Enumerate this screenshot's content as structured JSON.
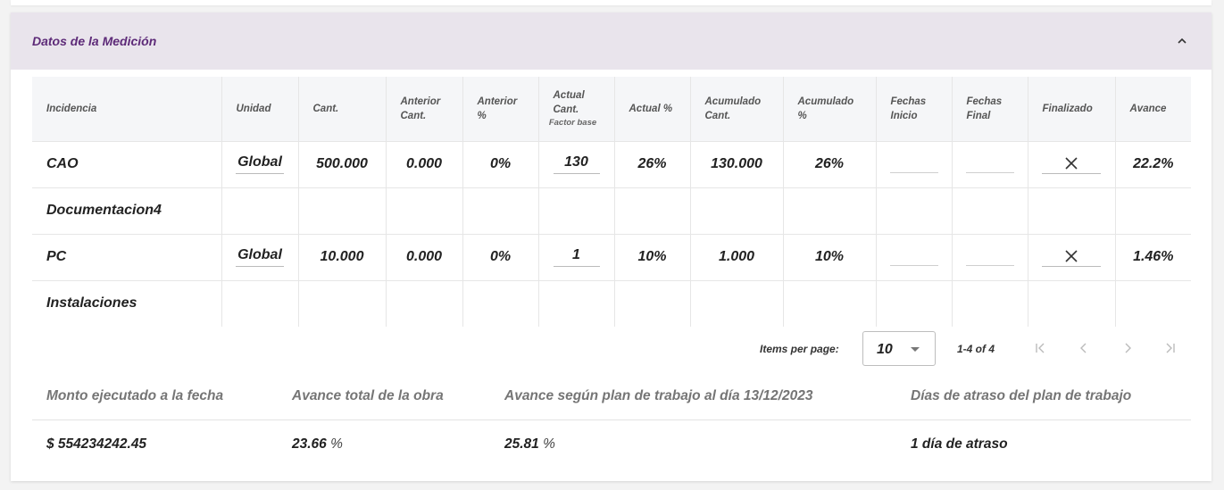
{
  "panel": {
    "title": "Datos de la Medición"
  },
  "table": {
    "headers": [
      "Incidencia",
      "Unidad",
      "Cant.",
      "Anterior Cant.",
      "Anterior %",
      "Actual Cant.",
      "Actual %",
      "Acumulado Cant.",
      "Acumulado %",
      "Fechas Inicio",
      "Fechas Final",
      "Finalizado",
      "Avance"
    ],
    "header_sub": "Factor base",
    "rows": [
      {
        "incidencia": "CAO",
        "unidad": "Global",
        "cant": "500.000",
        "ant_cant": "0.000",
        "ant_pct": "0%",
        "act_cant": "130",
        "act_pct": "26%",
        "acum_cant": "130.000",
        "acum_pct": "26%",
        "finalizado": "✕",
        "avance": "22.2%"
      },
      {
        "incidencia": "Documentacion4"
      },
      {
        "incidencia": "PC",
        "unidad": "Global",
        "cant": "10.000",
        "ant_cant": "0.000",
        "ant_pct": "0%",
        "act_cant": "1",
        "act_pct": "10%",
        "acum_cant": "1.000",
        "acum_pct": "10%",
        "finalizado": "✕",
        "avance": "1.46%"
      },
      {
        "incidencia": "Instalaciones"
      }
    ]
  },
  "paginator": {
    "items_per_page_label": "Items per page:",
    "page_size": "10",
    "range": "1-4 of 4"
  },
  "summary": {
    "headers": [
      "Monto ejecutado a la fecha",
      "Avance total de la obra",
      "Avance según plan de trabajo al día 13/12/2023",
      "Días de atraso del plan de trabajo"
    ],
    "monto": "$ 554234242.45",
    "avance_total": "23.66",
    "avance_plan": "25.81",
    "percent_unit": " %",
    "atraso": "1 día de atraso"
  },
  "icons": {
    "collapse": "chevron-up-icon",
    "first": "first-page-icon",
    "prev": "chevron-left-icon",
    "next": "chevron-right-icon",
    "last": "last-page-icon",
    "dropdown": "caret-down-icon"
  },
  "colors": {
    "accent": "#5d2a78",
    "header_bg": "#e9e4ec",
    "table_header_bg": "#f5f6f8"
  }
}
